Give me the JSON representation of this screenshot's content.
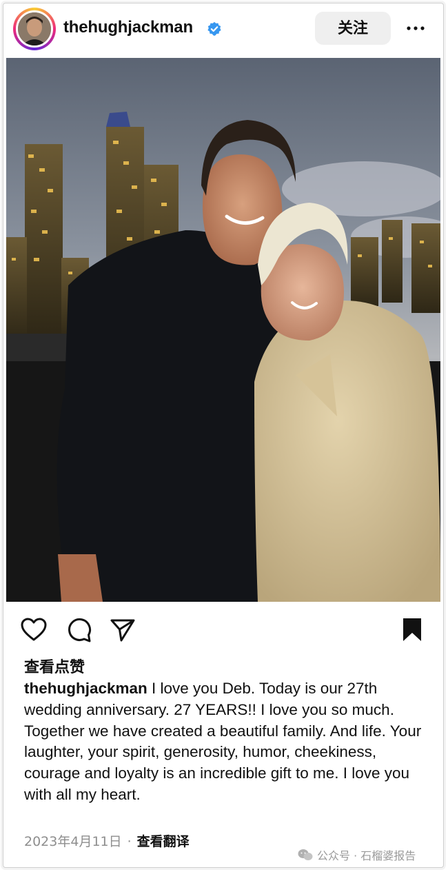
{
  "post": {
    "username": "thehughjackman",
    "follow_label": "关注",
    "likes_label": "查看点赞",
    "caption_user": "thehughjackman",
    "caption_text": " I love you Deb. Today is our 27th wedding anniversary. 27 YEARS!! I love you so much. Together we have created a beautiful family. And life. Your laughter, your spirit, generosity, humor, cheekiness, courage and loyalty is an incredible gift to me. I love you with all my heart.",
    "date": "2023年4月11日",
    "separator": "·",
    "translate_label": "查看翻译"
  },
  "icons": {
    "verified": "verified-badge-icon",
    "more": "more-horizontal-icon",
    "like": "heart-icon",
    "comment": "comment-icon",
    "share": "send-icon",
    "save": "bookmark-icon"
  },
  "colors": {
    "verified_blue": "#3797f0",
    "follow_bg": "#efefef",
    "muted_text": "#8e8e8e"
  },
  "watermark": {
    "text": "公众号 · 石榴婆报告"
  }
}
